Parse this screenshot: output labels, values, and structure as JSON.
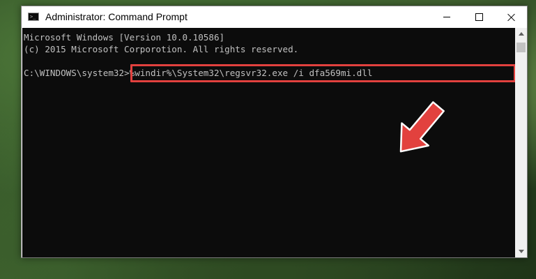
{
  "window": {
    "title": "Administrator: Command Prompt",
    "app_icon": "cmd-icon",
    "controls": {
      "minimize_icon": "minimize-icon",
      "maximize_icon": "maximize-icon",
      "close_icon": "close-icon"
    }
  },
  "console": {
    "line1": "Microsoft Windows [Version 10.0.10586]",
    "line2": "(c) 2015 Microsoft Corporotion. All rights reserved.",
    "prompt": "C:\\WINDOWS\\system32>",
    "command": "%windir%\\System32\\regsvr32.exe /i dfa569mi.dll",
    "colors": {
      "background": "#0c0c0c",
      "text": "#c0c0c0"
    }
  },
  "annotation": {
    "highlight_color": "#e2413e",
    "arrow_icon": "red-arrow-icon"
  },
  "app_icon_text": ">_"
}
